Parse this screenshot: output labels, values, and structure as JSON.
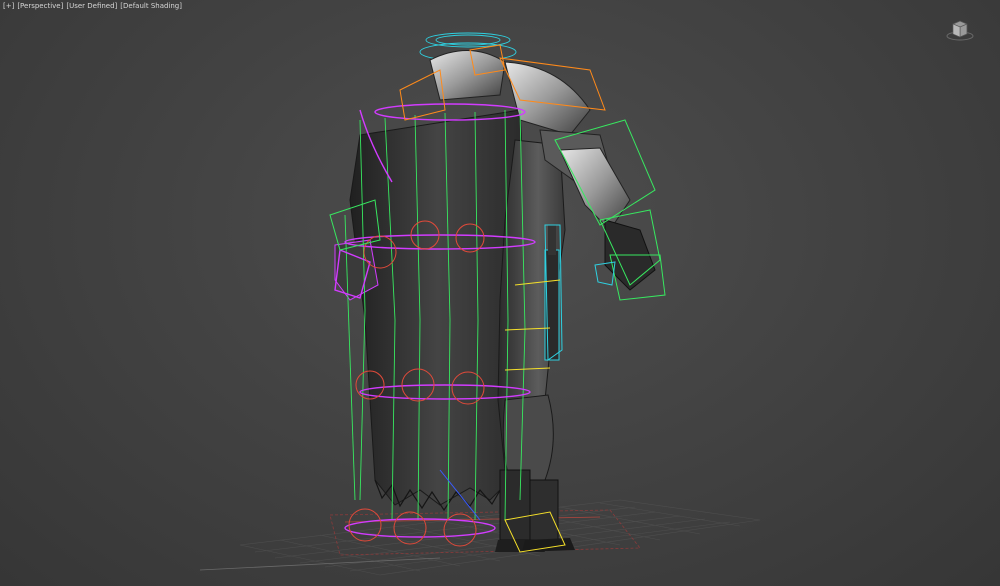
{
  "viewport": {
    "menu_label": "[+]",
    "view_label": "[Perspective]",
    "camera_label": "[User Defined]",
    "shading_label": "[Default Shading]"
  },
  "view_cube": {
    "icon": "view-cube-icon"
  },
  "colors": {
    "background": "#434343",
    "grid": "#5a5a5a",
    "grid_axis_x": "#7a3a3a",
    "rig_magenta": "#d23cff",
    "rig_green": "#38e860",
    "rig_orange": "#ff8a1a",
    "rig_yellow": "#f5e02a",
    "rig_cyan": "#2fd0e0",
    "rig_red": "#e23a3a",
    "mesh": "#2c2c2c"
  }
}
